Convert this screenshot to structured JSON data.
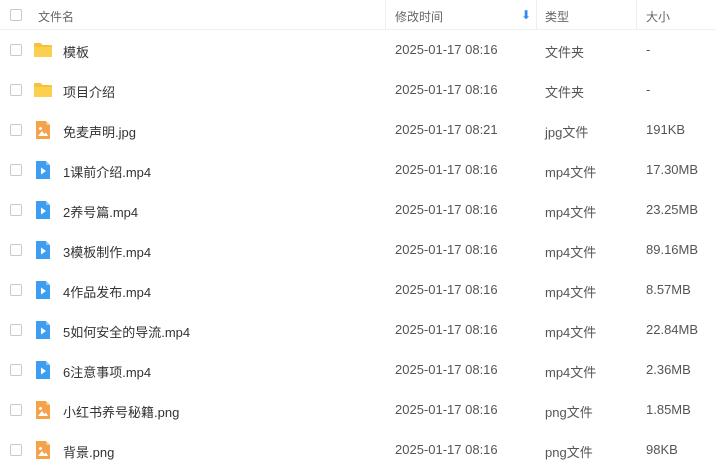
{
  "header": {
    "name_label": "文件名",
    "modified_label": "修改时间",
    "sort_icon": "arrow-down-icon",
    "type_label": "类型",
    "size_label": "大小"
  },
  "colors": {
    "folder": "#f7c23b",
    "image": "#f5a24b",
    "video": "#3d9df3",
    "sort_accent": "#2e8cf0"
  },
  "files": [
    {
      "icon": "folder-icon",
      "name": "模板",
      "modified": "2025-01-17 08:16",
      "type": "文件夹",
      "size": "-"
    },
    {
      "icon": "folder-icon",
      "name": "项目介绍",
      "modified": "2025-01-17 08:16",
      "type": "文件夹",
      "size": "-"
    },
    {
      "icon": "image-file-icon",
      "name": "免麦声明.jpg",
      "modified": "2025-01-17 08:21",
      "type": "jpg文件",
      "size": "191KB"
    },
    {
      "icon": "video-file-icon",
      "name": "1课前介绍.mp4",
      "modified": "2025-01-17 08:16",
      "type": "mp4文件",
      "size": "17.30MB"
    },
    {
      "icon": "video-file-icon",
      "name": "2养号篇.mp4",
      "modified": "2025-01-17 08:16",
      "type": "mp4文件",
      "size": "23.25MB"
    },
    {
      "icon": "video-file-icon",
      "name": "3模板制作.mp4",
      "modified": "2025-01-17 08:16",
      "type": "mp4文件",
      "size": "89.16MB"
    },
    {
      "icon": "video-file-icon",
      "name": "4作品发布.mp4",
      "modified": "2025-01-17 08:16",
      "type": "mp4文件",
      "size": "8.57MB"
    },
    {
      "icon": "video-file-icon",
      "name": "5如何安全的导流.mp4",
      "modified": "2025-01-17 08:16",
      "type": "mp4文件",
      "size": "22.84MB"
    },
    {
      "icon": "video-file-icon",
      "name": "6注意事项.mp4",
      "modified": "2025-01-17 08:16",
      "type": "mp4文件",
      "size": "2.36MB"
    },
    {
      "icon": "image-file-icon",
      "name": "小红书养号秘籍.png",
      "modified": "2025-01-17 08:16",
      "type": "png文件",
      "size": "1.85MB"
    },
    {
      "icon": "image-file-icon",
      "name": "背景.png",
      "modified": "2025-01-17 08:16",
      "type": "png文件",
      "size": "98KB"
    }
  ]
}
